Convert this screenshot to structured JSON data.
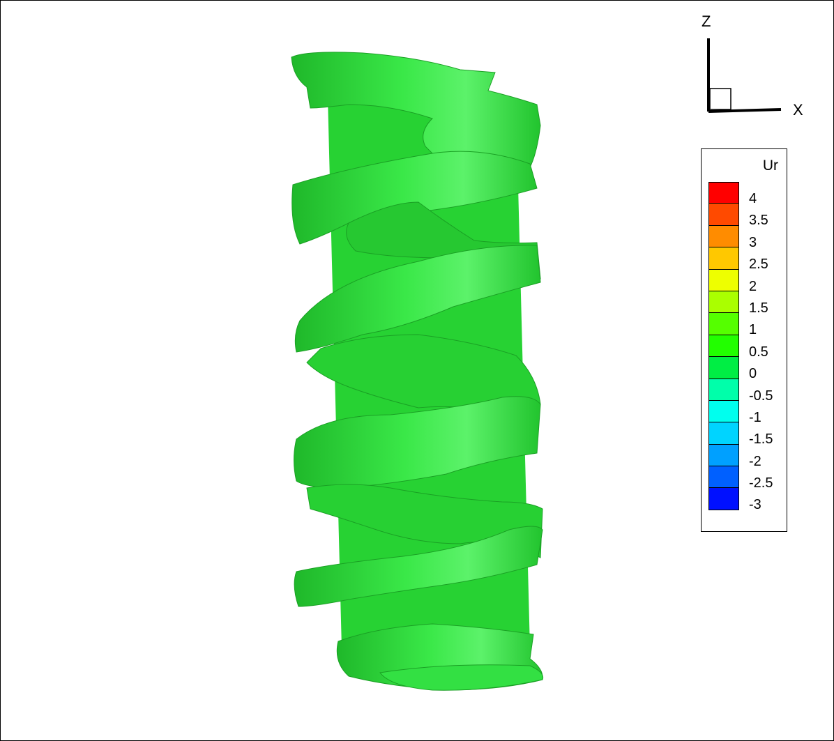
{
  "axes": {
    "vertical_label": "Z",
    "horizontal_label": "X"
  },
  "legend": {
    "title": "Ur",
    "levels": [
      "4",
      "3.5",
      "3",
      "2.5",
      "2",
      "1.5",
      "1",
      "0.5",
      "0",
      "-0.5",
      "-1",
      "-1.5",
      "-2",
      "-2.5",
      "-3"
    ],
    "colors": [
      "#ff0000",
      "#ff4a00",
      "#ff8c00",
      "#ffc800",
      "#eeff00",
      "#aaff00",
      "#55ff00",
      "#22ff00",
      "#00ee44",
      "#00ffaa",
      "#00ffee",
      "#00d4ff",
      "#00a0ff",
      "#0060ff",
      "#0010ff"
    ]
  },
  "isosurface": {
    "color": "#2ee23a",
    "shade": "#1fb82a",
    "highlight": "#5cf26a"
  }
}
